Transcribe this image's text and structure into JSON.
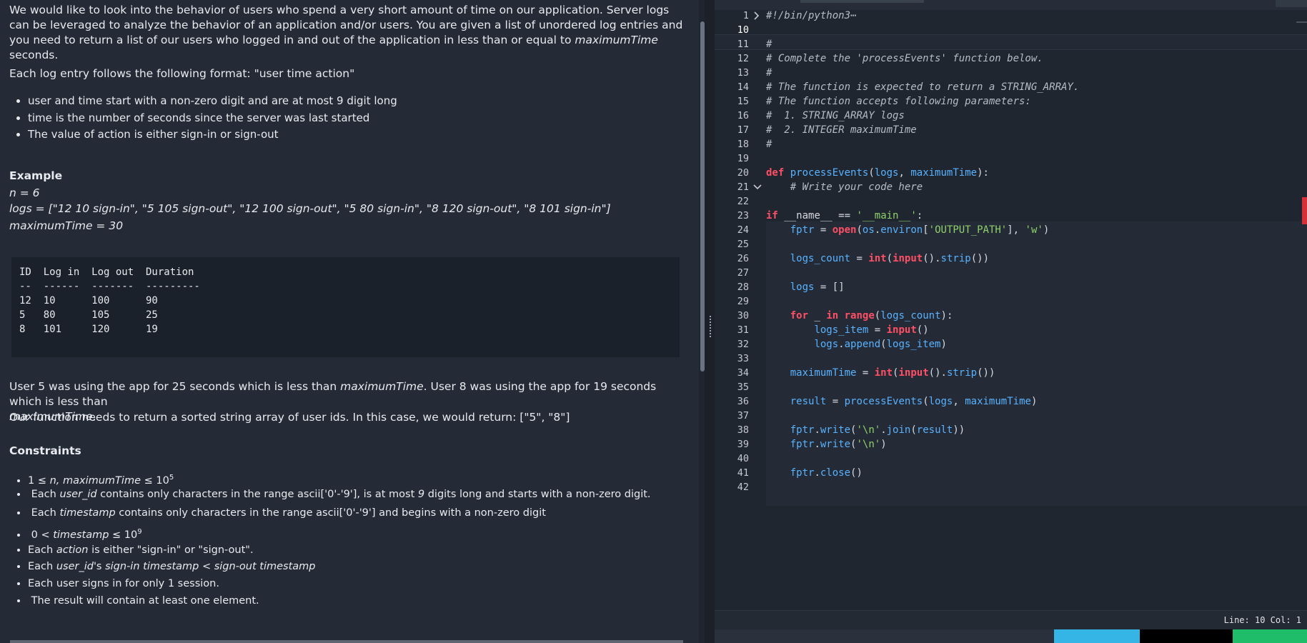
{
  "problem": {
    "intro": [
      {
        "text": "We would like to look into the behavior of users who spend a very short amount of time on our application. Server logs can be leveraged to analyze the behavior of an application and/or users. You are given a list of unordered log entries and you need to return a list of our users who logged in and out of the application in less than or equal to "
      },
      {
        "italic": "maximumTime"
      },
      {
        "text": " seconds."
      }
    ],
    "format_line": "Each log entry follows the following format: \"user time action\"",
    "bullets": [
      "user and time start with a non-zero digit and are at most 9 digit long",
      "time is the number of seconds since the server was last started",
      "The value of action is either sign-in or sign-out"
    ],
    "example_heading": "Example",
    "example_lines": [
      "n = 6",
      "logs = [\"12 10 sign-in\", \"5 105 sign-out\", \"12 100 sign-out\", \"5 80 sign-in\", \"8 120 sign-out\", \"8 101 sign-in\"]",
      "maximumTime = 30"
    ],
    "table_text": "ID  Log in  Log out  Duration\n--  ------  -------  ---------\n12  10      100      90\n5   80      105      25\n8   101     120      19",
    "explanation_1a": "User 5 was using the app for 25 seconds which is less than ",
    "explanation_1b": "maximumTime",
    "explanation_1c": ". User 8 was using the app for 19 seconds which is less than ",
    "explanation_1d": "maximumTime",
    "explanation_1e": ".",
    "explanation_2": "Our function needs to return a sorted string array of user ids. In this case, we would return: [\"5\", \"8\"]",
    "constraints_heading": "Constraints",
    "constraints": {
      "c1_pre": "1 ≤ ",
      "c1_n": "n, maximumTime",
      "c1_post": " ≤ 10",
      "c1_sup": "5",
      "c2_pre": "Each ",
      "c2_it": "user_id",
      "c2_post": " contains only characters in the range ascii['0'-'9'], is at most ",
      "c2_it2": "9",
      "c2_post2": " digits long and starts with a non-zero digit.",
      "c3_pre": "Each ",
      "c3_it": "timestamp",
      "c3_post": " contains only characters in the range ascii['0'-'9'] and begins with a non-zero digit",
      "c4_pre": "0 < ",
      "c4_it": "timestamp",
      "c4_post": " ≤ 10",
      "c4_sup": "9",
      "c5_pre": "Each ",
      "c5_it": "action",
      "c5_post": " is either \"sign-in\" or \"sign-out\".",
      "c6_pre": "Each ",
      "c6_it": "user_id",
      "c6_post": "'s ",
      "c6_it2": "sign-in timestamp < sign-out timestamp",
      "c7": "Each user signs in for only 1 session.",
      "c8": "The result will contain at least one element."
    }
  },
  "editor": {
    "lines": [
      {
        "n": "1",
        "code": "#!/bin/python3⋯"
      },
      {
        "n": "10",
        "code": ""
      },
      {
        "n": "11",
        "code": "#"
      },
      {
        "n": "12",
        "code": "# Complete the 'processEvents' function below."
      },
      {
        "n": "13",
        "code": "#"
      },
      {
        "n": "14",
        "code": "# The function is expected to return a STRING_ARRAY."
      },
      {
        "n": "15",
        "code": "# The function accepts following parameters:"
      },
      {
        "n": "16",
        "code": "#  1. STRING_ARRAY logs"
      },
      {
        "n": "17",
        "code": "#  2. INTEGER maximumTime"
      },
      {
        "n": "18",
        "code": "#"
      },
      {
        "n": "19",
        "code": ""
      },
      {
        "n": "20",
        "code": "def processEvents(logs, maximumTime):"
      },
      {
        "n": "21",
        "code": "    # Write your code here"
      },
      {
        "n": "22",
        "code": ""
      },
      {
        "n": "23",
        "code": "if __name__ == '__main__':"
      },
      {
        "n": "24",
        "code": "    fptr = open(os.environ['OUTPUT_PATH'], 'w')"
      },
      {
        "n": "25",
        "code": ""
      },
      {
        "n": "26",
        "code": "    logs_count = int(input().strip())"
      },
      {
        "n": "27",
        "code": ""
      },
      {
        "n": "28",
        "code": "    logs = []"
      },
      {
        "n": "29",
        "code": ""
      },
      {
        "n": "30",
        "code": "    for _ in range(logs_count):"
      },
      {
        "n": "31",
        "code": "        logs_item = input()"
      },
      {
        "n": "32",
        "code": "        logs.append(logs_item)"
      },
      {
        "n": "33",
        "code": ""
      },
      {
        "n": "34",
        "code": "    maximumTime = int(input().strip())"
      },
      {
        "n": "35",
        "code": ""
      },
      {
        "n": "36",
        "code": "    result = processEvents(logs, maximumTime)"
      },
      {
        "n": "37",
        "code": ""
      },
      {
        "n": "38",
        "code": "    fptr.write('\\n'.join(result))"
      },
      {
        "n": "39",
        "code": "    fptr.write('\\n')"
      },
      {
        "n": "40",
        "code": ""
      },
      {
        "n": "41",
        "code": "    fptr.close()"
      },
      {
        "n": "42",
        "code": ""
      }
    ],
    "status": "Line: 10 Col: 1",
    "icons": [
      "chevron-right-icon",
      "chevron-down-icon"
    ]
  },
  "colors": {
    "keyword": "#ff4f66",
    "string": "#8fd16a",
    "function": "#58b2ff",
    "custom_button": "#35b5e5",
    "submit_button": "#1fbd6a"
  }
}
